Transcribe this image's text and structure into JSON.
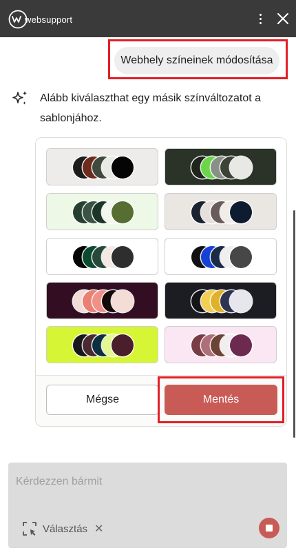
{
  "header": {
    "brand_text": "websupport",
    "brand_mark": "W",
    "menu_icon": "more-vertical-icon",
    "close_icon": "close-icon"
  },
  "user_message": "Webhely színeinek módosítása",
  "assistant_message": "Alább kiválaszthat egy másik színváltozatot a sablonjához.",
  "assistant_icon": "sparkle-icon",
  "palettes": [
    {
      "bg": "#eeecea",
      "colors": [
        "#1c1c1c",
        "#6e2a1c",
        "#3e4a3c",
        "#e9e9e5",
        "#050505"
      ]
    },
    {
      "bg": "#2b3328",
      "colors": [
        "#1f251c",
        "#6cd64a",
        "#8a8f88",
        "#3c4438",
        "#e8e8e4"
      ]
    },
    {
      "bg": "#edf8e6",
      "colors": [
        "#264030",
        "#3a5444",
        "#1d3428",
        "#f1f7ed",
        "#566e32"
      ]
    },
    {
      "bg": "#eae6e2",
      "colors": [
        "#1b2230",
        "#e6e0dc",
        "#6a5c5a",
        "#f0ece8",
        "#0e1c30"
      ]
    },
    {
      "bg": "#ffffff",
      "colors": [
        "#060606",
        "#0c4a30",
        "#27483a",
        "#f6e9e3",
        "#2e2e2e"
      ]
    },
    {
      "bg": "#ffffff",
      "colors": [
        "#111111",
        "#1640d6",
        "#1b2a46",
        "#efefef",
        "#474747"
      ]
    },
    {
      "bg": "#330e22",
      "colors": [
        "#f3dcd8",
        "#ea7f74",
        "#f09088",
        "#150a0a",
        "#f3ddd6"
      ]
    },
    {
      "bg": "#1c1d22",
      "colors": [
        "#131318",
        "#f2cf52",
        "#e0b22c",
        "#2d3350",
        "#e6e6ec"
      ]
    },
    {
      "bg": "#d6f534",
      "colors": [
        "#18181c",
        "#4a2a30",
        "#0c3040",
        "#e2f890",
        "#4a1e2a"
      ]
    },
    {
      "bg": "#fbe6f4",
      "colors": [
        "#7a3c44",
        "#ae7078",
        "#6c4436",
        "#f2eef0",
        "#6c2a50"
      ]
    }
  ],
  "buttons": {
    "cancel": "Mégse",
    "save": "Mentés"
  },
  "composer": {
    "placeholder": "Kérdezzen bármit",
    "selection_label": "Választás",
    "selection_icon": "select-area-icon",
    "remove_icon": "close-icon",
    "stop_icon": "stop-icon"
  },
  "colors": {
    "header_bg": "#3a3a3a",
    "accent": "#c95b57",
    "highlight_frame": "#e41d25"
  }
}
